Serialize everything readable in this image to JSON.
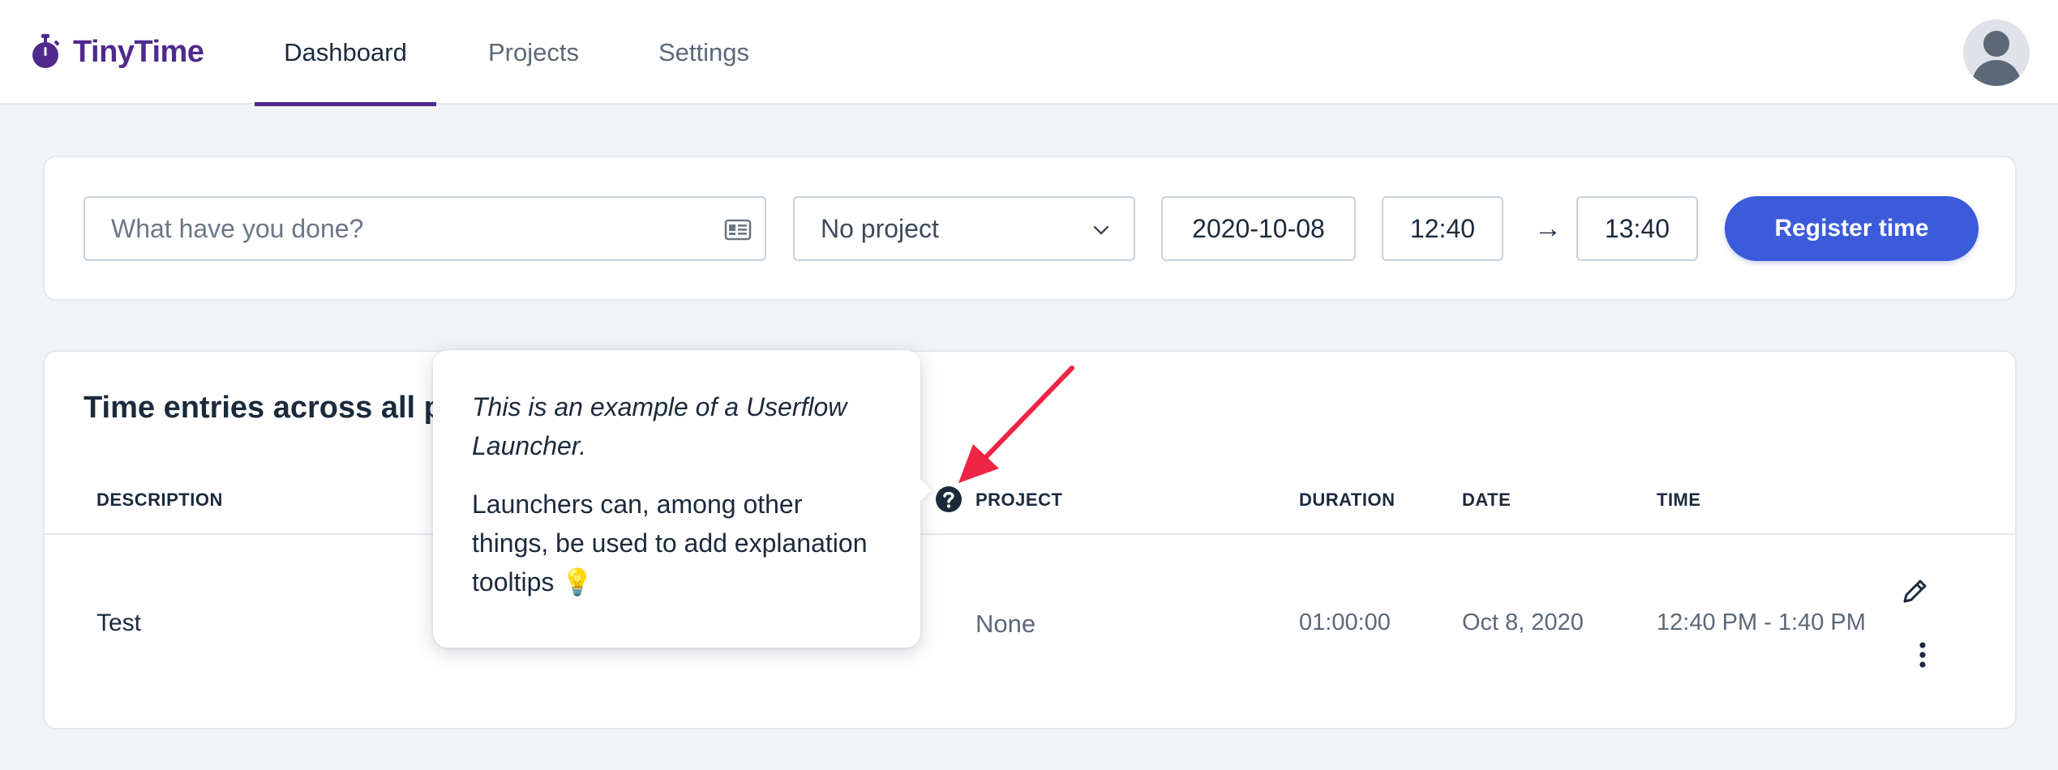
{
  "app": {
    "name": "TinyTime",
    "logo_icon": "stopwatch-icon",
    "brand_color": "#4f2a8c",
    "accent_color": "#3b5bdb"
  },
  "nav": {
    "tabs": [
      {
        "label": "Dashboard",
        "active": true
      },
      {
        "label": "Projects",
        "active": false
      },
      {
        "label": "Settings",
        "active": false
      }
    ]
  },
  "entry_form": {
    "description_placeholder": "What have you done?",
    "project_selected": "No project",
    "date": "2020-10-08",
    "start_time": "12:40",
    "arrow": "→",
    "end_time": "13:40",
    "register_label": "Register time"
  },
  "entries": {
    "title": "Time entries across all projects",
    "columns": {
      "description": "DESCRIPTION",
      "project": "PROJECT",
      "duration": "DURATION",
      "date": "DATE",
      "time": "TIME"
    },
    "rows": [
      {
        "description": "Test",
        "project": "None",
        "duration": "01:00:00",
        "date": "Oct 8, 2020",
        "time": "12:40 PM - 1:40 PM"
      }
    ]
  },
  "tooltip": {
    "lead": "This is an example of a Userflow Launcher.",
    "body": "Launchers can, among other things, be used to add explanation tooltips 💡"
  }
}
